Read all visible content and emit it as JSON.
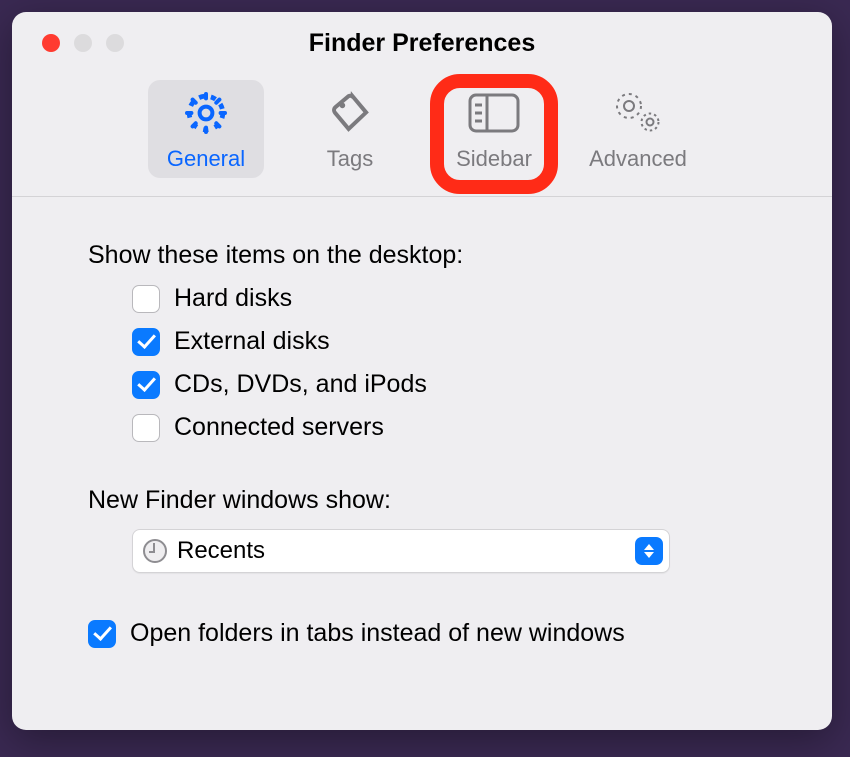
{
  "window": {
    "title": "Finder Preferences"
  },
  "tabs": {
    "general": {
      "label": "General"
    },
    "tags": {
      "label": "Tags"
    },
    "sidebar": {
      "label": "Sidebar"
    },
    "advanced": {
      "label": "Advanced"
    }
  },
  "desktop_items": {
    "heading": "Show these items on the desktop:",
    "hard_disks": {
      "label": "Hard disks",
      "checked": false
    },
    "external_disks": {
      "label": "External disks",
      "checked": true
    },
    "cds_dvds_ipods": {
      "label": "CDs, DVDs, and iPods",
      "checked": true
    },
    "connected_servers": {
      "label": "Connected servers",
      "checked": false
    }
  },
  "new_windows": {
    "heading": "New Finder windows show:",
    "value": "Recents"
  },
  "open_in_tabs": {
    "label": "Open folders in tabs instead of new windows",
    "checked": true
  },
  "colors": {
    "accent": "#0a7aff",
    "highlight": "#ff2b17"
  }
}
